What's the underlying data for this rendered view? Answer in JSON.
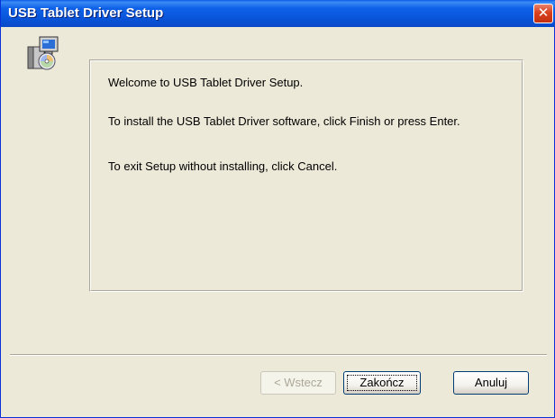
{
  "window": {
    "title": "USB Tablet Driver Setup",
    "close_glyph": "✕"
  },
  "icons": {
    "setup": "setup-installer-icon",
    "close": "close-icon"
  },
  "content": {
    "welcome": "Welcome to USB Tablet Driver Setup.",
    "install_instructions": "To install the USB Tablet Driver software, click Finish or press Enter.",
    "exit_instructions": "To exit Setup without installing, click Cancel."
  },
  "buttons": {
    "back_label": "< Wstecz",
    "finish_label": "Zakończ",
    "cancel_label": "Anuluj"
  },
  "colors": {
    "titlebar": "#0954d9",
    "background": "#ece9d8",
    "close_button": "#d9411f"
  }
}
